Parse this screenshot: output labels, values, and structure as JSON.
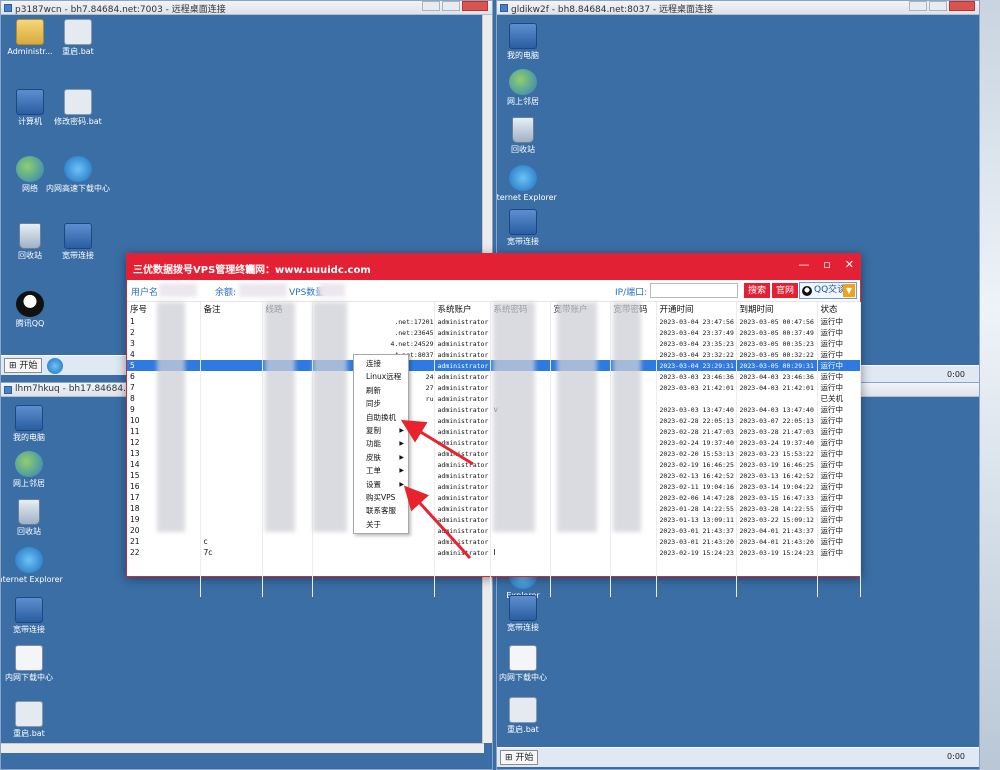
{
  "windows": {
    "top_left_title": "p3187wcn - bh7.84684.net:7003 - 远程桌面连接",
    "top_right_title": "gldikw2f - bh8.84684.net:8037 - 远程桌面连接",
    "bottom_left_title": "lhm7hkuq - bh17.84684.net:17"
  },
  "desktop_icons_left": [
    {
      "label": "Administr...",
      "kind": "folder"
    },
    {
      "label": "重启.bat",
      "kind": "bat"
    },
    {
      "label": "计算机",
      "kind": "pc"
    },
    {
      "label": "修改密码.bat",
      "kind": "bat"
    },
    {
      "label": "网络",
      "kind": "net"
    },
    {
      "label": "内网高速下载中心",
      "kind": "ie"
    },
    {
      "label": "回收站",
      "kind": "bin"
    },
    {
      "label": "宽带连接",
      "kind": "pc"
    },
    {
      "label": "腾讯QQ",
      "kind": "qq"
    }
  ],
  "desktop_icons_right": [
    {
      "label": "我的电脑"
    },
    {
      "label": "网上邻居"
    },
    {
      "label": "回收站"
    },
    {
      "label": "Internet Explorer"
    },
    {
      "label": "宽带连接"
    }
  ],
  "desktop_icons_bottom_left": [
    {
      "label": "我的电脑"
    },
    {
      "label": "网上邻居"
    },
    {
      "label": "回收站"
    },
    {
      "label": "Internet Explorer"
    },
    {
      "label": "宽带连接"
    },
    {
      "label": "内网下载中心"
    },
    {
      "label": "重启.bat"
    }
  ],
  "desktop_icons_bottom_right": [
    {
      "label": "Explorer"
    },
    {
      "label": "宽带连接"
    },
    {
      "label": "内网下载中心"
    },
    {
      "label": "重启.bat"
    }
  ],
  "taskbar": {
    "start_label": "开始",
    "clock": "0:00"
  },
  "app": {
    "title": "三优数据拨号VPS管理终端",
    "website": "官网：www.uuuidc.com",
    "user_label": "用户名",
    "balance_label": "余额:",
    "vps_count_label": "VPS数量",
    "ip_port_label": "IP/端口:",
    "search_value": "",
    "search_button": "搜索",
    "official_button": "官网",
    "qq_button": "QQ交谈",
    "columns": [
      "序号",
      "备注",
      "线路",
      "",
      "系统账户",
      "系统密码",
      "宽带账户",
      "宽带密码",
      "开通时间",
      "到期时间",
      "状态"
    ],
    "rows": [
      [
        "1",
        "",
        "",
        ".net:17201",
        "administrator",
        "",
        "",
        "",
        "2023-03-04 23:47:56",
        "2023-03-05 00:47:56",
        "运行中"
      ],
      [
        "2",
        "",
        "",
        ".net:23645",
        "administrator",
        "",
        "",
        "",
        "2023-03-04 23:37:49",
        "2023-03-05 00:37:49",
        "运行中"
      ],
      [
        "3",
        "",
        "",
        "4.net:24529",
        "administrator",
        "",
        "",
        "",
        "2023-03-04 23:35:23",
        "2023-03-05 00:35:23",
        "运行中"
      ],
      [
        "4",
        "",
        "",
        "4.net:8037",
        "administrator",
        "",
        "",
        "",
        "2023-03-04 23:32:22",
        "2023-03-05 00:32:22",
        "运行中"
      ],
      [
        "5",
        "",
        "",
        "",
        "administrator",
        "",
        "",
        "",
        "2023-03-04 23:29:31",
        "2023-03-05 00:29:31",
        "运行中"
      ],
      [
        "6",
        "",
        "",
        "24",
        "administrator",
        "",
        "",
        "",
        "2023-03-03 23:46:36",
        "2023-04-03 23:46:36",
        "运行中"
      ],
      [
        "7",
        "",
        "",
        "27",
        "administrator",
        "",
        "",
        "",
        "2023-03-03 21:42:01",
        "2023-04-03 21:42:01",
        "运行中"
      ],
      [
        "8",
        "",
        "",
        "ru",
        "administrator",
        "",
        "",
        "",
        "",
        "",
        "已关机"
      ],
      [
        "9",
        "",
        "",
        "",
        "administrator",
        "v",
        "",
        "",
        "2023-03-03 13:47:40",
        "2023-04-03 13:47:40",
        "运行中"
      ],
      [
        "10",
        "",
        "",
        "",
        "administrator",
        "",
        "",
        "",
        "2023-02-28 22:05:13",
        "2023-03-07 22:05:13",
        "运行中"
      ],
      [
        "11",
        "",
        "",
        "",
        "administrator",
        "",
        "",
        "",
        "2023-02-28 21:47:03",
        "2023-03-28 21:47:03",
        "运行中"
      ],
      [
        "12",
        "",
        "",
        "",
        "administrator",
        "",
        "",
        "",
        "2023-02-24 19:37:40",
        "2023-03-24 19:37:40",
        "运行中"
      ],
      [
        "13",
        "",
        "",
        "",
        "administrator",
        "",
        "",
        "",
        "2023-02-20 15:53:13",
        "2023-03-23 15:53:22",
        "运行中"
      ],
      [
        "14",
        "",
        "",
        "",
        "administrator",
        "",
        "",
        "",
        "2023-02-19 16:46:25",
        "2023-03-19 16:46:25",
        "运行中"
      ],
      [
        "15",
        "",
        "",
        "",
        "administrator",
        "",
        "",
        "",
        "2023-02-13 16:42:52",
        "2023-03-13 16:42:52",
        "运行中"
      ],
      [
        "16",
        "",
        "",
        "",
        "administrator",
        "",
        "",
        "",
        "2023-02-11 19:04:16",
        "2023-03-14 19:04:22",
        "运行中"
      ],
      [
        "17",
        "",
        "",
        "",
        "administrator",
        "",
        "",
        "",
        "2023-02-06 14:47:28",
        "2023-03-15 16:47:33",
        "运行中"
      ],
      [
        "18",
        "",
        "",
        "",
        "administrator",
        "",
        "",
        "",
        "2023-01-28 14:22:55",
        "2023-03-28 14:22:55",
        "运行中"
      ],
      [
        "19",
        "",
        "",
        "",
        "administrator",
        "",
        "",
        "",
        "2023-01-13 13:09:11",
        "2023-03-22 15:09:12",
        "运行中"
      ],
      [
        "20",
        "",
        "",
        "",
        "administrator",
        "",
        "",
        "",
        "2023-03-01 21:43:37",
        "2023-04-01 21:43:37",
        "运行中"
      ],
      [
        "21",
        "c",
        "",
        "",
        "administrator",
        "",
        "",
        "",
        "2023-03-01 21:43:20",
        "2023-04-01 21:43:20",
        "运行中"
      ],
      [
        "22",
        "7c",
        "",
        "",
        "administrator",
        "I",
        "",
        "",
        "2023-02-19 15:24:23",
        "2023-03-19 15:24:23",
        "运行中"
      ]
    ],
    "selected_row_index": 4
  },
  "context_menu": {
    "items": [
      {
        "label": "连接",
        "submenu": false
      },
      {
        "label": "Linux远程",
        "submenu": false
      },
      {
        "label": "刷新",
        "submenu": false
      },
      {
        "label": "同步",
        "submenu": false
      },
      {
        "label": "自助换机",
        "submenu": false
      },
      {
        "label": "复制",
        "submenu": true
      },
      {
        "label": "功能",
        "submenu": true
      },
      {
        "label": "皮肤",
        "submenu": true
      },
      {
        "label": "工单",
        "submenu": true
      },
      {
        "label": "设置",
        "submenu": true
      },
      {
        "label": "购买VPS",
        "submenu": false
      },
      {
        "label": "联系客服",
        "submenu": false
      },
      {
        "label": "关于",
        "submenu": false
      }
    ]
  },
  "colors": {
    "app_accent": "#e42035",
    "selection": "#2f7ae0",
    "desktop": "#3a6ea5",
    "annotation_arrow": "#e8232e"
  }
}
